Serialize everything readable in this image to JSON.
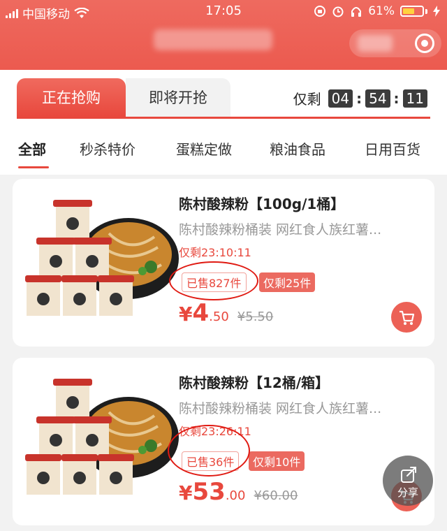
{
  "status_bar": {
    "carrier": "中国移动",
    "time": "17:05",
    "battery_percent": "61%"
  },
  "tabs": {
    "active": "正在抢购",
    "inactive": "即将开抢"
  },
  "countdown": {
    "label": "仅剩",
    "hours": "04",
    "minutes": "54",
    "seconds": "11",
    "separator": ":"
  },
  "categories": [
    "全部",
    "秒杀特价",
    "蛋糕定做",
    "粮油食品",
    "日用百货"
  ],
  "products": [
    {
      "title": "陈村酸辣粉【100g/1桶】",
      "subtitle": "陈村酸辣粉桶装 网红食人族红薯...",
      "timer": "仅剩23:10:11",
      "sold": "已售827件",
      "stock_left": "仅剩25件",
      "price_symbol": "¥",
      "price_int": "4",
      "price_dec": ".50",
      "original_price": "¥5.50"
    },
    {
      "title": "陈村酸辣粉【12桶/箱】",
      "subtitle": "陈村酸辣粉桶装 网红食人族红薯...",
      "timer": "仅剩23:26:11",
      "sold": "已售36件",
      "stock_left": "仅剩10件",
      "price_symbol": "¥",
      "price_int": "53",
      "price_dec": ".00",
      "original_price": "¥60.00"
    }
  ],
  "share": {
    "label": "分享"
  },
  "colors": {
    "brand_red": "#e8483d",
    "header_red": "#ee6a5f",
    "annotation_red": "#e01a12"
  }
}
